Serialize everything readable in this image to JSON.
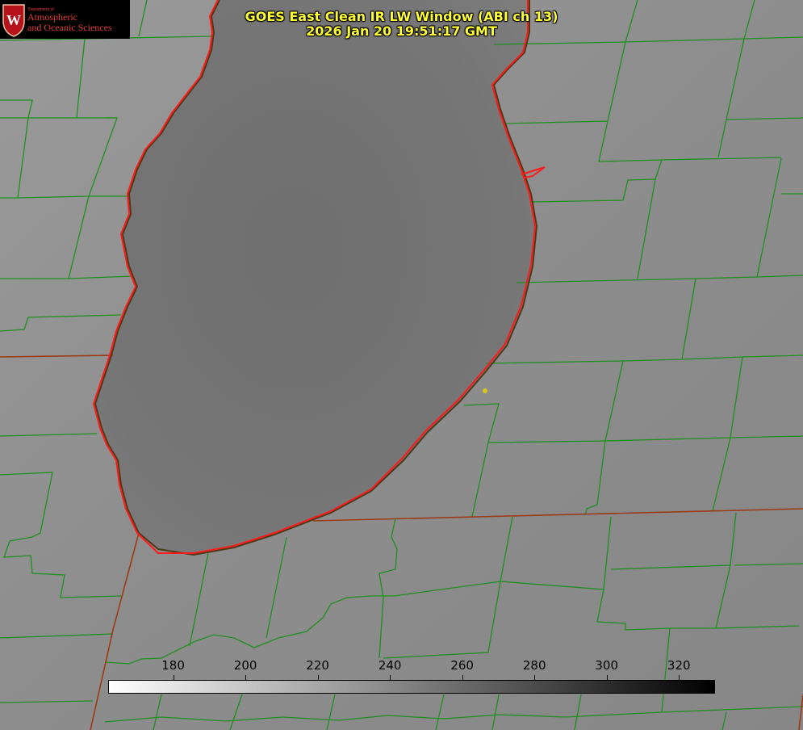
{
  "title": {
    "line1": "GOES East Clean IR LW Window (ABI ch 13)",
    "line2": "2026 Jan 20 19:51:17 GMT"
  },
  "logo": {
    "department": "Department of",
    "line1": "Atmospheric",
    "line2": "and Oceanic Sciences",
    "crest_letter": "W"
  },
  "colorbar": {
    "min": 162,
    "max": 330,
    "unit": "K",
    "ticks": [
      180,
      200,
      220,
      240,
      260,
      280,
      300,
      320
    ],
    "gradient": [
      "#ffffff",
      "#000000"
    ]
  },
  "colors": {
    "lake_fill": "#767676",
    "land_fill": "#8e8e8e",
    "shoreline": "#ff1a1a",
    "county_lines": "#1f8f1f",
    "state_lines": "#9a3b14",
    "title_text": "#ffff33",
    "station_marker": "#d6c81e"
  },
  "map": {
    "feature": "Lake Michigan (southern basin)",
    "projection": "satellite view",
    "overlays": [
      "county boundaries",
      "state boundaries",
      "shoreline"
    ]
  }
}
